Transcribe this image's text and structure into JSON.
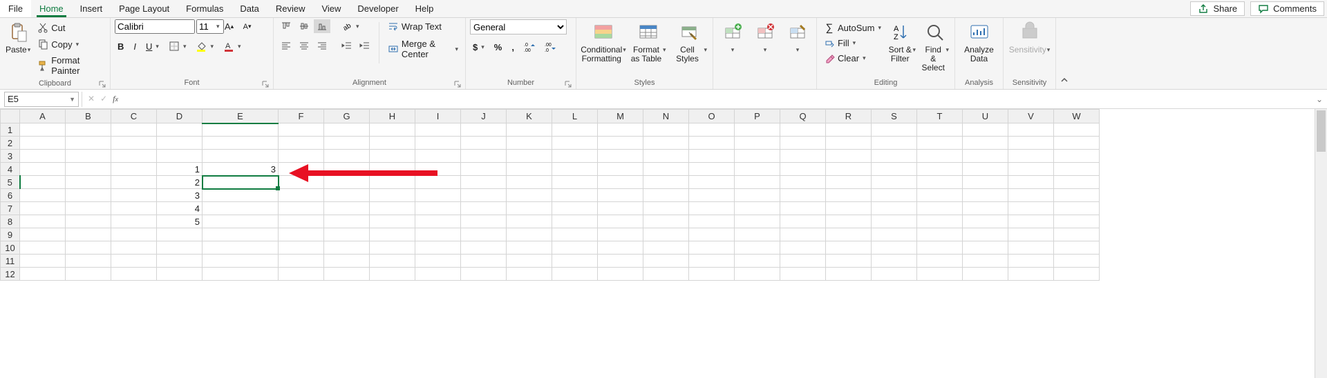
{
  "tabs": {
    "file": "File",
    "home": "Home",
    "insert": "Insert",
    "page_layout": "Page Layout",
    "formulas": "Formulas",
    "data": "Data",
    "review": "Review",
    "view": "View",
    "developer": "Developer",
    "help": "Help"
  },
  "top_right": {
    "share": "Share",
    "comments": "Comments"
  },
  "clipboard": {
    "paste": "Paste",
    "cut": "Cut",
    "copy": "Copy",
    "format_painter": "Format Painter",
    "group": "Clipboard"
  },
  "font": {
    "name": "Calibri",
    "size": "11",
    "group": "Font"
  },
  "alignment": {
    "wrap": "Wrap Text",
    "merge": "Merge & Center",
    "group": "Alignment"
  },
  "number": {
    "format": "General",
    "group": "Number"
  },
  "styles": {
    "cond": "Conditional Formatting",
    "table": "Format as Table",
    "cell": "Cell Styles",
    "group": "Styles"
  },
  "cells": {
    "D4": "1",
    "D5": "2",
    "D6": "3",
    "D7": "4",
    "D8": "5",
    "E4": "3"
  },
  "editing": {
    "autosum": "AutoSum",
    "fill": "Fill",
    "clear": "Clear",
    "sort": "Sort & Filter",
    "find": "Find & Select",
    "group": "Editing"
  },
  "analysis": {
    "analyze": "Analyze Data",
    "group": "Analysis"
  },
  "sensitivity": {
    "label": "Sensitivity",
    "group": "Sensitivity"
  },
  "namebox": "E5",
  "formula": "",
  "columns": [
    "A",
    "B",
    "C",
    "D",
    "E",
    "F",
    "G",
    "H",
    "I",
    "J",
    "K",
    "L",
    "M",
    "N",
    "O",
    "P",
    "Q",
    "R",
    "S",
    "T",
    "U",
    "V",
    "W"
  ],
  "rows": [
    1,
    2,
    3,
    4,
    5,
    6,
    7,
    8,
    9,
    10,
    11,
    12
  ],
  "selected": "E5"
}
